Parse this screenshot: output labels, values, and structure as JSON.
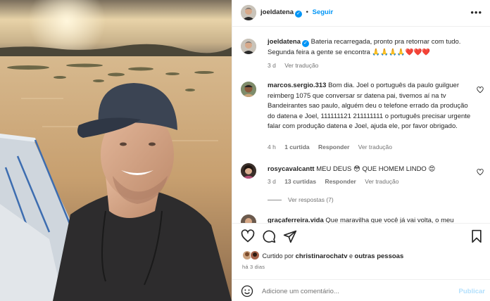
{
  "post": {
    "username": "joeldatena",
    "follow_label": "Seguir",
    "separator": "•"
  },
  "caption": {
    "username": "joeldatena",
    "text": "Bateria recarregada, pronto pra retornar com tudo. Segunda feira a gente se encontra 🙏🙏🙏🙏❤️❤️❤️",
    "age": "3 d",
    "translate": "Ver tradução"
  },
  "comments": [
    {
      "username": "marcos.sergio.313",
      "text": "Bom dia. Joel o português da paulo guilguer reimberg 1075 que conversar sr datena pai, tivemos aí na tv Bandeirantes sao paulo, alguém deu o telefone errado da produção do datena e Joel, 111111121 211111111 o português precisar urgente falar com produção datena e Joel, ajuda ele, por favor obrigado.",
      "age": "4 h",
      "likes": "1 curtida",
      "reply": "Responder",
      "translate": "Ver tradução"
    },
    {
      "username": "rosycavalcantt",
      "text": "MEU DEUS 😳 QUE HOMEM LINDO 😍",
      "age": "3 d",
      "likes": "13 curtidas",
      "reply": "Responder",
      "translate": "Ver tradução",
      "view_replies": "Ver respostas (7)"
    },
    {
      "username": "graçaferreira.vida",
      "text": "Que maravilha que você já vai volta, o meu"
    }
  ],
  "likes": {
    "prefix": "Curtido por",
    "user": "christinarochatv",
    "joiner": "e",
    "others": "outras pessoas"
  },
  "timestamp": "há 3 dias",
  "add_comment": {
    "placeholder": "Adicione um comentário...",
    "publish": "Publicar"
  },
  "colors": {
    "link_blue": "#0095f6",
    "meta_gray": "#737373",
    "publish_disabled": "#b2dffc"
  },
  "icons": [
    "verified-badge-icon",
    "more-options-icon",
    "heart-icon",
    "comment-icon",
    "share-icon",
    "save-icon",
    "emoji-icon"
  ]
}
